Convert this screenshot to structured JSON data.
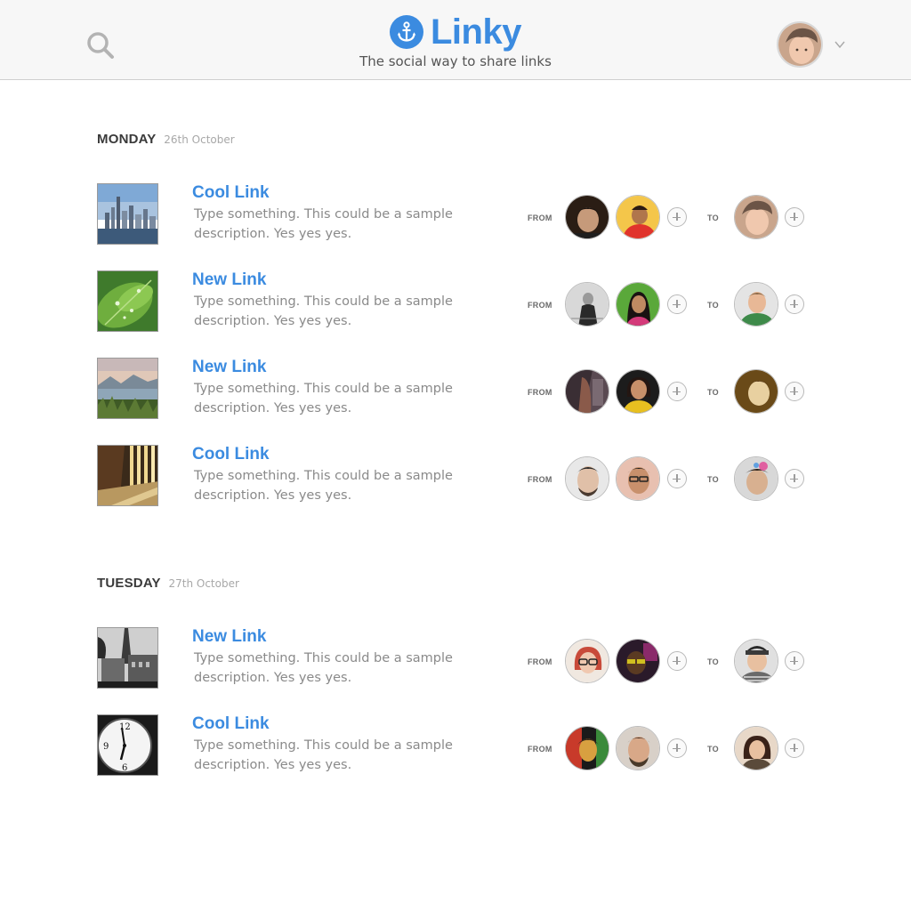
{
  "app": {
    "name": "Linky",
    "tagline": "The social way to share links",
    "brand_color": "#3b8be0"
  },
  "icons": {
    "search": "search-icon",
    "logo": "anchor-icon",
    "chevron": "chevron-down-icon",
    "add": "plus-circle-icon"
  },
  "labels": {
    "from": "FROM",
    "to": "TO"
  },
  "days": [
    {
      "name": "MONDAY",
      "date": "26th October",
      "links": [
        {
          "title": "Cool Link",
          "description": "Type something. This could be a sample description. Yes yes yes.",
          "thumbnail": "city-skyline"
        },
        {
          "title": "New Link",
          "description": "Type something. This could be a sample description. Yes yes yes.",
          "thumbnail": "green-leaf"
        },
        {
          "title": "New Link",
          "description": "Type something. This could be a sample description. Yes yes yes.",
          "thumbnail": "lake-landscape"
        },
        {
          "title": "Cool Link",
          "description": "Type something. This could be a sample description. Yes yes yes.",
          "thumbnail": "sunlit-corridor"
        }
      ]
    },
    {
      "name": "TUESDAY",
      "date": "27th October",
      "links": [
        {
          "title": "New Link",
          "description": "Type something. This could be a sample description. Yes yes yes.",
          "thumbnail": "tower-street"
        },
        {
          "title": "Cool Link",
          "description": "Type something. This could be a sample description. Yes yes yes.",
          "thumbnail": "clock-face"
        }
      ]
    }
  ]
}
